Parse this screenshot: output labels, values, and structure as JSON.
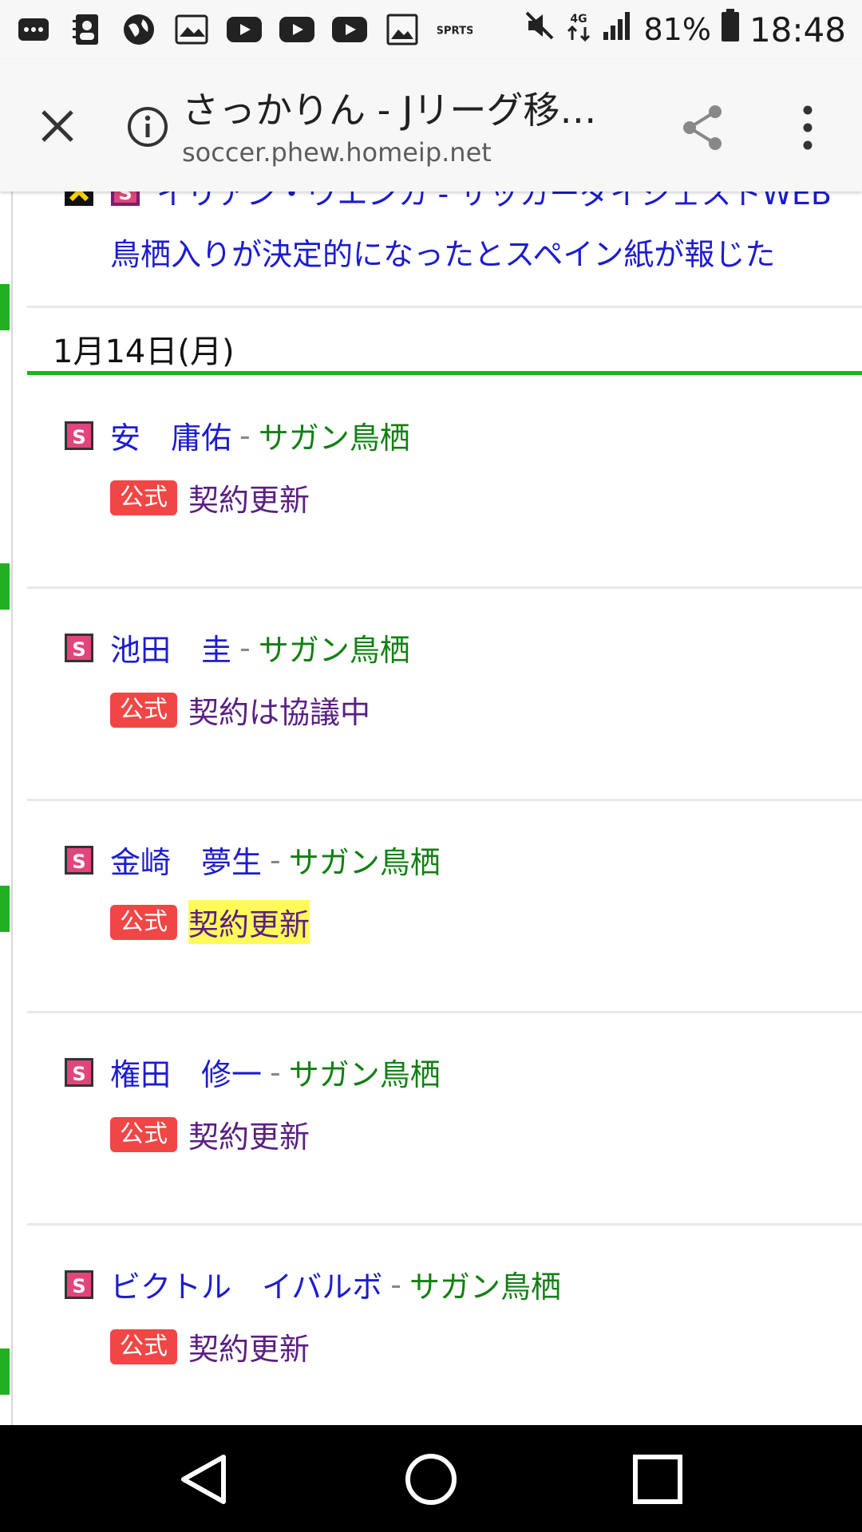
{
  "status_bar": {
    "battery_percent": "81%",
    "time": "18:48",
    "network": "4G",
    "icons": [
      "more-icon",
      "contacts-icon",
      "globe-icon",
      "au-icon",
      "youtube-icon",
      "youtube-icon",
      "youtube-icon",
      "gallery-icon",
      "sports-icon",
      "muted-icon",
      "network-4g-icon",
      "signal-icon",
      "battery-icon"
    ]
  },
  "browser": {
    "title": "さっかりん - Jリーグ移…",
    "url": "soccer.phew.homeip.net"
  },
  "partial_item": {
    "headline_cut": "イリアン・ウエンカ - サッカーダイジェストWEB",
    "headline": "鳥栖入りが決定的になったとスペイン紙が報じた"
  },
  "date_header": "1月14日(月)",
  "items": [
    {
      "player": "安　庸佑",
      "separator": "-",
      "club": "サガン鳥栖",
      "badge": "公式",
      "status": "契約更新",
      "highlight": false
    },
    {
      "player": "池田　圭",
      "separator": "-",
      "club": "サガン鳥栖",
      "badge": "公式",
      "status": "契約は協議中",
      "highlight": false
    },
    {
      "player": "金崎　夢生",
      "separator": "-",
      "club": "サガン鳥栖",
      "badge": "公式",
      "status": "契約更新",
      "highlight": true
    },
    {
      "player": "権田　修一",
      "separator": "-",
      "club": "サガン鳥栖",
      "badge": "公式",
      "status": "契約更新",
      "highlight": false
    },
    {
      "player": "ビクトル　イバルボ",
      "separator": "-",
      "club": "サガン鳥栖",
      "badge": "公式",
      "status": "契約更新",
      "highlight": false
    }
  ],
  "colors": {
    "accent_green": "#22b022",
    "link_blue": "#1c1ccf",
    "club_green": "#128012",
    "badge_red": "#f04646",
    "status_purple": "#5a1f82",
    "highlight_yellow": "#fff95a"
  }
}
